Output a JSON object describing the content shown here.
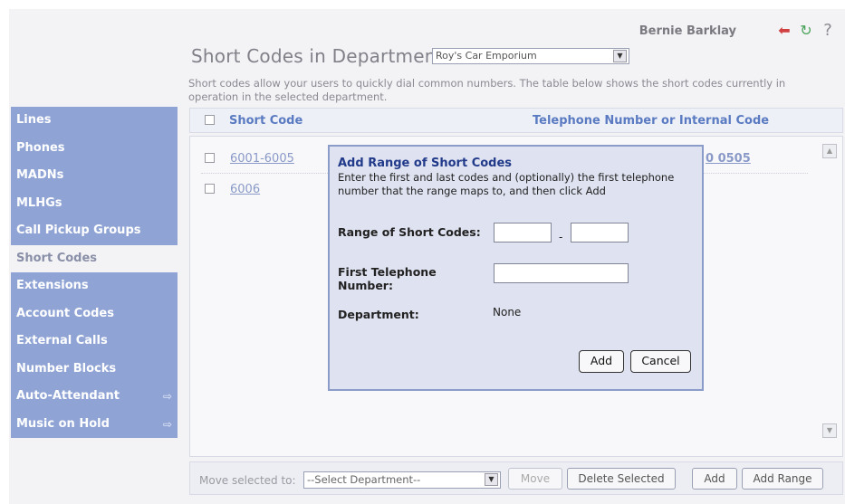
{
  "header": {
    "user_name": "Bernie Barklay",
    "icons": [
      "logout-icon",
      "refresh-icon",
      "help-icon"
    ],
    "title": "Short Codes in Department:",
    "department_selected": "Roy's Car Emporium"
  },
  "description": "Short codes allow your users to quickly dial common numbers. The table below shows the short codes currently in operation in the selected department.",
  "sidebar": {
    "items": [
      {
        "label": "Lines"
      },
      {
        "label": "Phones"
      },
      {
        "label": "MADNs"
      },
      {
        "label": "MLHGs"
      },
      {
        "label": "Call Pickup Groups"
      },
      {
        "label": "Short Codes",
        "active": true
      },
      {
        "label": "Extensions"
      },
      {
        "label": "Account Codes"
      },
      {
        "label": "External Calls"
      },
      {
        "label": "Number Blocks"
      },
      {
        "label": "Auto-Attendant",
        "external": true
      },
      {
        "label": "Music on Hold",
        "external": true
      }
    ]
  },
  "table": {
    "columns": [
      "Short Code",
      "Telephone Number or Internal Code"
    ],
    "rows": [
      {
        "code": "6001-6005",
        "telephone": "0 0505"
      },
      {
        "code": "6006",
        "telephone": ""
      }
    ]
  },
  "footer": {
    "move_label": "Move selected to:",
    "move_placeholder": "--Select Department--",
    "move_button": "Move",
    "delete_button": "Delete Selected",
    "add_button": "Add",
    "add_range_button": "Add Range"
  },
  "dialog": {
    "title": "Add  Range of Short Codes",
    "instructions": "Enter the first and last codes and (optionally) the first telephone number that the range maps to, and then click Add",
    "range_label": "Range of Short Codes:",
    "range_separator": "-",
    "first_tel_label": "First Telephone Number:",
    "department_label": "Department:",
    "department_value": "None",
    "add_button": "Add",
    "cancel_button": "Cancel"
  },
  "colors": {
    "sidebar": "#8fa3d5",
    "dialog_bg": "#dfe2f0",
    "dialog_border": "#8c9cc9",
    "header_link": "#5a7bc2"
  }
}
